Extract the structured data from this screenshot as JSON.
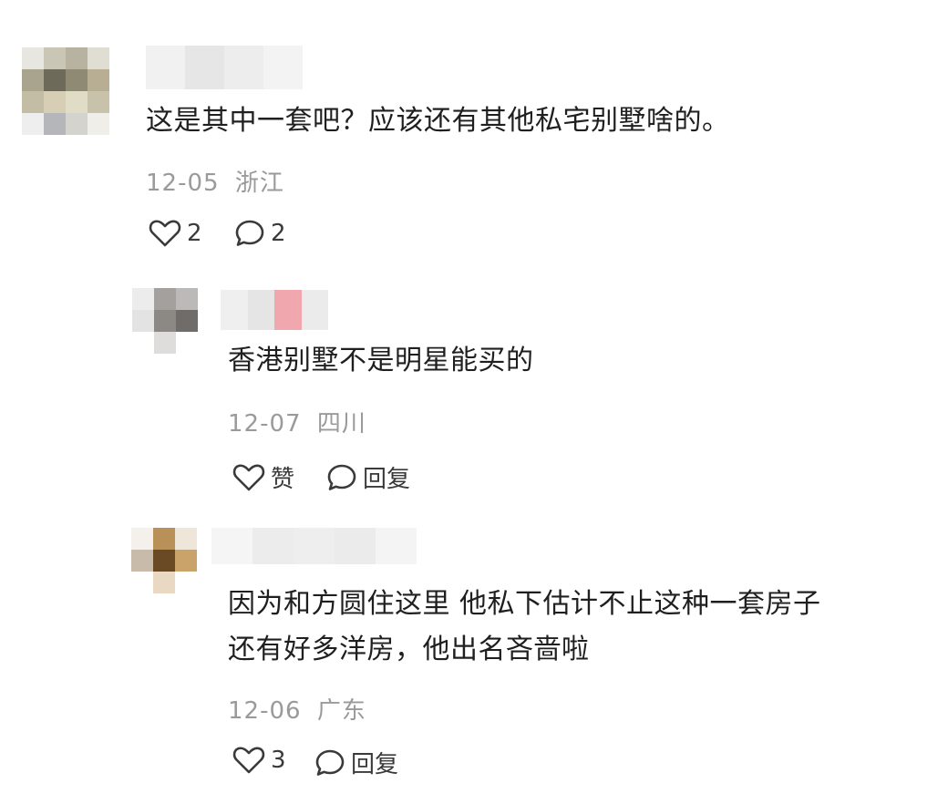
{
  "comments": [
    {
      "content_lines": [
        "这是其中一套吧？应该还有其他私宅别墅啥的。"
      ],
      "date": "12-05",
      "location": "浙江",
      "like_label": "2",
      "reply_label": "2"
    },
    {
      "content_lines": [
        "香港别墅不是明星能买的"
      ],
      "date": "12-07",
      "location": "四川",
      "like_label": "赞",
      "reply_label": "回复"
    },
    {
      "content_lines": [
        "因为和方圆住这里 他私下估计不止这种一套房子",
        "还有好多洋房，他出名吝啬啦"
      ],
      "date": "12-06",
      "location": "广东",
      "like_label": "3",
      "reply_label": "回复"
    }
  ],
  "icons": {
    "like": "heart-outline-icon",
    "reply": "speech-bubble-icon"
  },
  "colors": {
    "text": "#1f1f1f",
    "meta": "#9a9a9a",
    "icon": "#3a3a3a"
  }
}
